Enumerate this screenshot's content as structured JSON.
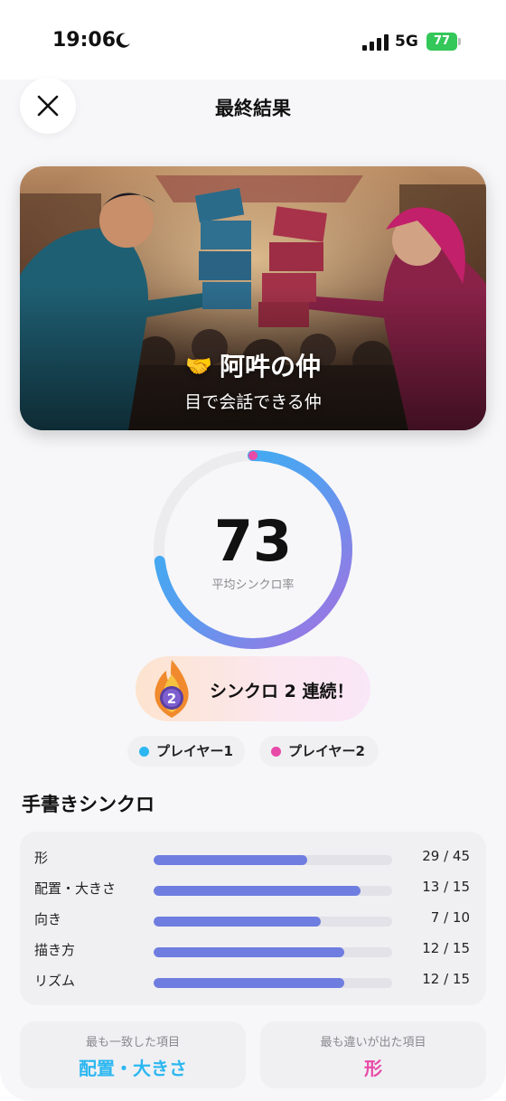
{
  "status_bar": {
    "time": "19:06",
    "network": "5G",
    "battery": "77"
  },
  "header": {
    "title": "最終結果"
  },
  "hero": {
    "title": "阿吽の仲",
    "subtitle": "目で会話できる仲"
  },
  "score": {
    "value": "73",
    "label": "平均シンクロ率",
    "percent": 73
  },
  "streak": {
    "count_badge": "2",
    "text": "シンクロ 2 連続！"
  },
  "legend": [
    {
      "label": "プレイヤー1",
      "color": "#2cb7f0"
    },
    {
      "label": "プレイヤー2",
      "color": "#e84aa8"
    }
  ],
  "section": {
    "title": "手書きシンクロ"
  },
  "stats": [
    {
      "label": "形",
      "value": "29 / 45",
      "score": 29,
      "max": 45
    },
    {
      "label": "配置・大きさ",
      "value": "13 / 15",
      "score": 13,
      "max": 15
    },
    {
      "label": "向き",
      "value": "7 / 10",
      "score": 7,
      "max": 10
    },
    {
      "label": "描き方",
      "value": "12 / 15",
      "score": 12,
      "max": 15
    },
    {
      "label": "リズム",
      "value": "12 / 15",
      "score": 12,
      "max": 15
    }
  ],
  "summary": {
    "best_caption": "最も一致した項目",
    "best_value": "配置・大きさ",
    "worst_caption": "最も違いが出た項目",
    "worst_value": "形"
  },
  "colors": {
    "bar_fill": "#6f7de0",
    "best_value": "#2cb7f0",
    "worst_value": "#e84aa8",
    "gauge_start": "#2cb7f0",
    "gauge_end": "#a86ee0"
  },
  "icons": [
    "close-icon",
    "moon-icon",
    "signal-icon",
    "handshake-icon",
    "flame-icon"
  ]
}
